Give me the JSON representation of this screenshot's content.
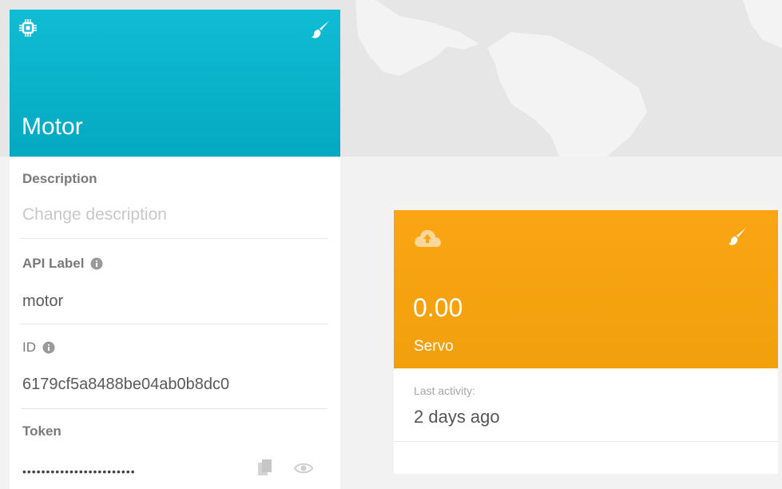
{
  "device": {
    "title": "Motor",
    "header_color": "#0cb6ce",
    "icons": {
      "chip": "chip-icon",
      "brush": "paint-brush-icon"
    },
    "description": {
      "label": "Description",
      "placeholder": "Change description"
    },
    "api_label": {
      "label": "API Label",
      "value": "motor"
    },
    "id": {
      "label": "ID",
      "value": "6179cf5a8488be04ab0b8dc0"
    },
    "token": {
      "label": "Token",
      "masked_value": "••••••••••••••••••••••••"
    }
  },
  "variable": {
    "value": "0.00",
    "name": "Servo",
    "header_color": "#f7a410",
    "icons": {
      "cloud": "cloud-upload-icon",
      "brush": "paint-brush-icon"
    },
    "last_activity_label": "Last activity:",
    "last_activity_value": "2 days ago"
  },
  "map": {
    "background_color": "#e6e6e6",
    "land_color": "#f3f3f3"
  }
}
